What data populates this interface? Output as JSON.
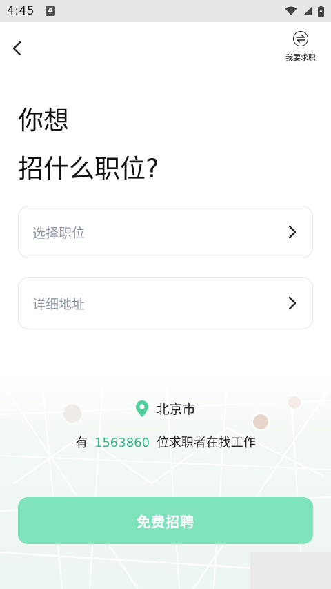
{
  "status_bar": {
    "time": "4:45",
    "notification_icon": "A"
  },
  "header": {
    "back_icon": "chevron-left-icon",
    "switch_label": "我要求职",
    "switch_icon": "swap-icon"
  },
  "title": {
    "line1": "你想",
    "line2": "招什么职位?"
  },
  "fields": {
    "position_placeholder": "选择职位",
    "address_placeholder": "详细地址"
  },
  "location": {
    "city": "北京市",
    "count_prefix": "有",
    "count": "1563860",
    "count_suffix": "位求职者在找工作"
  },
  "actions": {
    "post_button": "免费招聘"
  },
  "colors": {
    "accent": "#2fb88a",
    "button": "#7fe3bb",
    "field_border": "#e3e6ea",
    "placeholder": "#8d98a6"
  }
}
